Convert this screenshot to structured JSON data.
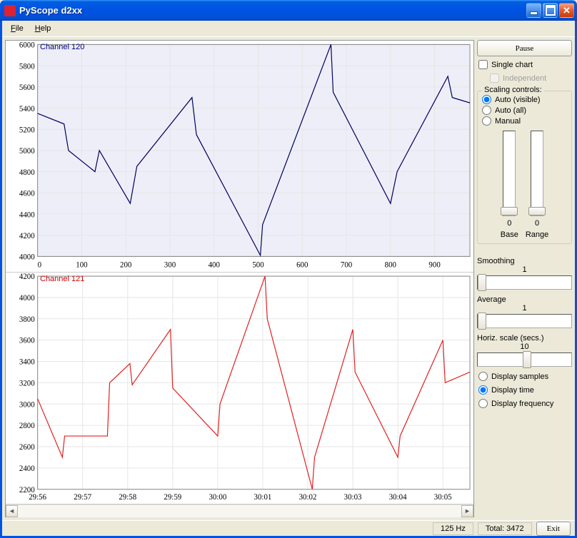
{
  "window": {
    "title": "PyScope d2xx"
  },
  "menu": {
    "file": "File",
    "help": "Help"
  },
  "sidebar": {
    "pause": "Pause",
    "single_chart": "Single chart",
    "independent": "Independent",
    "scaling_legend": "Scaling controls:",
    "scaling_options": {
      "auto_visible": "Auto (visible)",
      "auto_all": "Auto (all)",
      "manual": "Manual"
    },
    "slider_base_val": "0",
    "slider_range_val": "0",
    "slider_base_label": "Base",
    "slider_range_label": "Range",
    "smoothing_label": "Smoothing",
    "smoothing_val": "1",
    "average_label": "Average",
    "average_val": "1",
    "hscale_label": "Horiz. scale (secs.)",
    "hscale_val": "10",
    "display_samples": "Display samples",
    "display_time": "Display time",
    "display_frequency": "Display frequency"
  },
  "status": {
    "hz": "125 Hz",
    "total": "Total: 3472",
    "exit": "Exit"
  },
  "chart_data": [
    {
      "type": "line",
      "title": "Channel 120",
      "color": "#000060",
      "xlabel": "",
      "ylabel": "",
      "xlim": [
        0,
        980
      ],
      "ylim": [
        4000,
        6000
      ],
      "x_ticks": [
        0,
        100,
        200,
        300,
        400,
        500,
        600,
        700,
        800,
        900
      ],
      "y_ticks": [
        4000,
        4200,
        4400,
        4600,
        4800,
        5000,
        5200,
        5400,
        5600,
        5800,
        6000
      ],
      "x": [
        0,
        60,
        70,
        130,
        140,
        210,
        225,
        350,
        360,
        505,
        510,
        665,
        670,
        800,
        815,
        930,
        940,
        980
      ],
      "values": [
        5350,
        5250,
        5000,
        4800,
        5000,
        4500,
        4850,
        5500,
        5150,
        4010,
        4300,
        6000,
        5550,
        4500,
        4800,
        5700,
        5500,
        5450
      ]
    },
    {
      "type": "line",
      "title": "Channel 121",
      "color": "#e02020",
      "xlabel": "",
      "ylabel": "",
      "x_tick_labels": [
        "29:56",
        "29:57",
        "29:58",
        "29:59",
        "30:00",
        "30:01",
        "30:02",
        "30:03",
        "30:04",
        "30:05"
      ],
      "ylim": [
        2200,
        4200
      ],
      "y_ticks": [
        2200,
        2400,
        2600,
        2800,
        3000,
        3200,
        3400,
        3600,
        3800,
        4000,
        4200
      ],
      "x": [
        0,
        0.55,
        0.6,
        1.55,
        1.6,
        2.05,
        2.1,
        2.95,
        3.0,
        4.0,
        4.05,
        5.05,
        5.1,
        6.1,
        6.15,
        7.0,
        7.05,
        8.0,
        8.05,
        9.0,
        9.05,
        9.6
      ],
      "values": [
        3050,
        2500,
        2700,
        2700,
        3200,
        3380,
        3180,
        3700,
        3150,
        2700,
        3000,
        4200,
        3800,
        2200,
        2500,
        3700,
        3300,
        2500,
        2700,
        3600,
        3200,
        3300
      ]
    }
  ]
}
